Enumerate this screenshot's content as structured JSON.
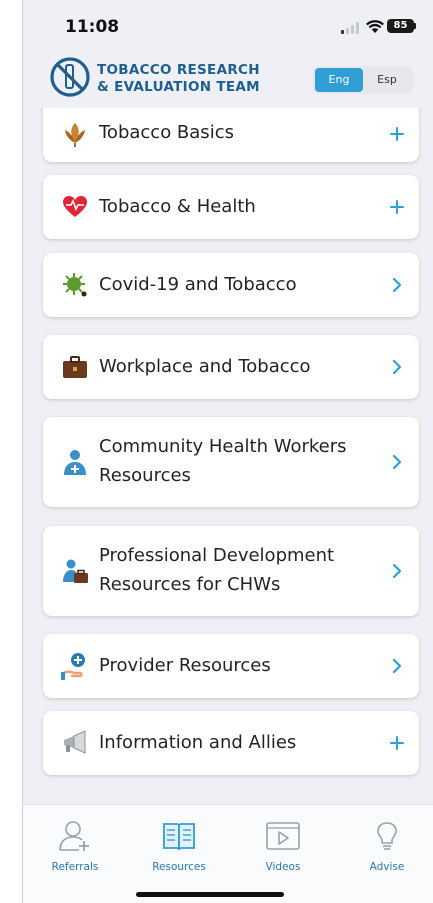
{
  "status_bar": {
    "time": "11:08",
    "battery": "85"
  },
  "header": {
    "logo_line1": "TOBACCO RESEARCH",
    "logo_line2": "& EVALUATION TEAM",
    "lang_active": "Eng",
    "lang_other": "Esp"
  },
  "menu": {
    "items": [
      {
        "label": "Tobacco Basics",
        "action": "expand"
      },
      {
        "label": "Tobacco & Health",
        "action": "expand"
      },
      {
        "label": "Covid-19 and Tobacco",
        "action": "navigate"
      },
      {
        "label": "Workplace and Tobacco",
        "action": "navigate"
      },
      {
        "label_line1": "Community Health Workers",
        "label_line2": "Resources",
        "action": "navigate"
      },
      {
        "label_line1": "Professional Development",
        "label_line2": "Resources for CHWs",
        "action": "navigate"
      },
      {
        "label": "Provider Resources",
        "action": "navigate"
      },
      {
        "label": "Information and Allies",
        "action": "expand"
      }
    ]
  },
  "tabbar": {
    "tabs": [
      {
        "label": "Referrals",
        "icon": "referral-user-icon"
      },
      {
        "label": "Resources",
        "icon": "book-icon"
      },
      {
        "label": "Videos",
        "icon": "play-icon"
      },
      {
        "label": "Advise",
        "icon": "lightbulb-icon"
      }
    ]
  },
  "colors": {
    "accent": "#2f9fd6",
    "brand": "#1e5f8f",
    "tab_label": "#2a79b2"
  }
}
